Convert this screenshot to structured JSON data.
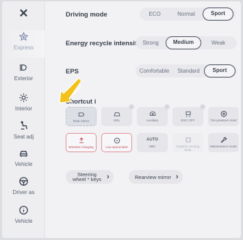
{
  "sidebar": {
    "close_glyph": "✕",
    "items": [
      {
        "label": "Express",
        "icon": "star-icon",
        "active": true
      },
      {
        "label": "Exterior",
        "icon": "light-icon",
        "active": false
      },
      {
        "label": "Interior",
        "icon": "sun-icon",
        "active": false
      },
      {
        "label": "Seat adj",
        "icon": "seat-icon",
        "active": false
      },
      {
        "label": "Vehicle",
        "icon": "car-icon",
        "active": false
      },
      {
        "label": "Driver as",
        "icon": "wheel-icon",
        "active": false
      },
      {
        "label": "Vehicle",
        "icon": "info-icon",
        "active": false
      }
    ]
  },
  "driving_mode": {
    "label": "Driving mode",
    "options": [
      "ECO",
      "Normal",
      "Sport"
    ],
    "selected": "Sport"
  },
  "energy_recycle": {
    "label": "Energy recycle intensity",
    "options": [
      "Strong",
      "Medium",
      "Weak"
    ],
    "selected": "Medium"
  },
  "eps": {
    "label": "EPS",
    "options": [
      "Comfortable",
      "Standard",
      "Sport"
    ],
    "selected": "Sport"
  },
  "shortcut": {
    "label": "Shortcut i",
    "row1": [
      {
        "label": "Rear mirror",
        "icon": "mirror-icon"
      },
      {
        "label": "HDL",
        "icon": "headlight-icon"
      },
      {
        "label": "Auxiliary",
        "icon": "aux-icon"
      },
      {
        "label": "ESC OFF",
        "icon": "esc-icon"
      },
      {
        "label": "Tire pressure reset",
        "icon": "tire-icon"
      }
    ],
    "row2": [
      {
        "label": "Wireless charging",
        "icon": "wireless-icon"
      },
      {
        "label": "Low speed alert",
        "icon": "speaker-icon"
      },
      {
        "label": "AUTO HBC",
        "icon": "auto-icon"
      },
      {
        "label": "Daytime running lamp",
        "icon": "drl-icon"
      },
      {
        "label": "Maintenance mode",
        "icon": "wrench-icon"
      }
    ]
  },
  "steering_wheel": {
    "label": "Steering wheel * keys"
  },
  "rearview_mirror": {
    "label": "Rearview mirror"
  },
  "colors": {
    "accent": "#434a58",
    "selected_tile_border": "#e08e96",
    "arrow": "#f2c21b"
  }
}
